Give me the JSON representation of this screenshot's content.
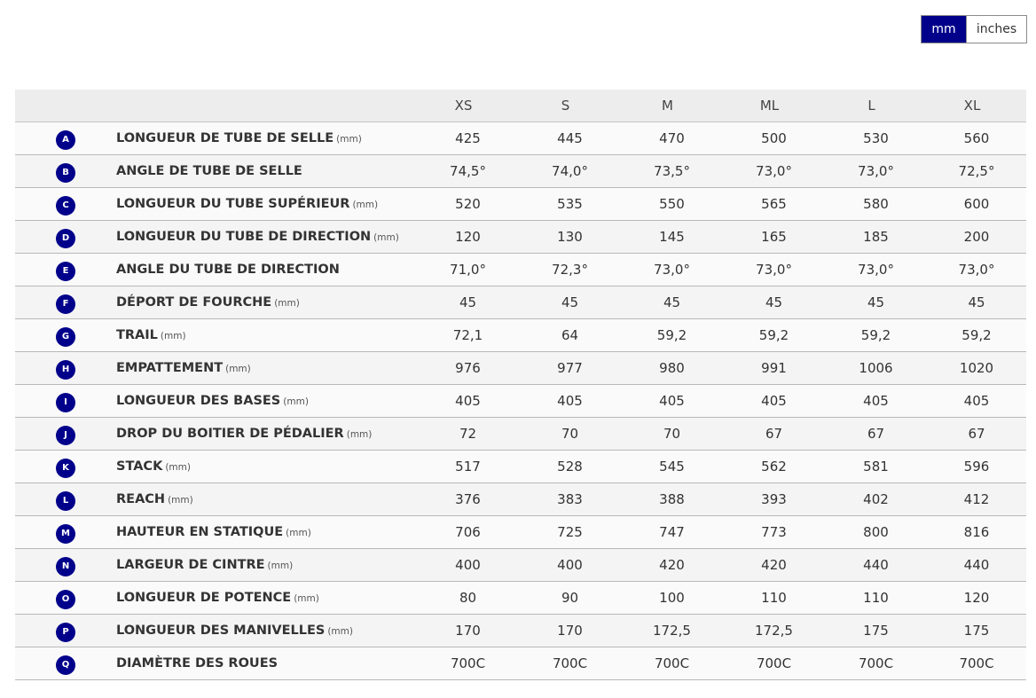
{
  "unit_toggle": {
    "options": [
      "mm",
      "inches"
    ],
    "selected": "mm"
  },
  "colors": {
    "accent": "#00008b",
    "header_bg": "#ededed",
    "row_odd": "#fafafa",
    "row_even": "#f4f4f4"
  },
  "table": {
    "sizes": [
      "XS",
      "S",
      "M",
      "ML",
      "L",
      "XL"
    ],
    "rows": [
      {
        "letter": "A",
        "label": "LONGUEUR DE TUBE DE SELLE",
        "unit": "(mm)",
        "values": [
          "425",
          "445",
          "470",
          "500",
          "530",
          "560"
        ]
      },
      {
        "letter": "B",
        "label": "ANGLE DE TUBE DE SELLE",
        "unit": "",
        "values": [
          "74,5°",
          "74,0°",
          "73,5°",
          "73,0°",
          "73,0°",
          "72,5°"
        ]
      },
      {
        "letter": "C",
        "label": "LONGUEUR DU TUBE SUPÉRIEUR",
        "unit": "(mm)",
        "values": [
          "520",
          "535",
          "550",
          "565",
          "580",
          "600"
        ]
      },
      {
        "letter": "D",
        "label": "LONGUEUR DU TUBE DE DIRECTION",
        "unit": "(mm)",
        "values": [
          "120",
          "130",
          "145",
          "165",
          "185",
          "200"
        ]
      },
      {
        "letter": "E",
        "label": "ANGLE DU TUBE DE DIRECTION",
        "unit": "",
        "values": [
          "71,0°",
          "72,3°",
          "73,0°",
          "73,0°",
          "73,0°",
          "73,0°"
        ]
      },
      {
        "letter": "F",
        "label": "DÉPORT DE FOURCHE",
        "unit": "(mm)",
        "values": [
          "45",
          "45",
          "45",
          "45",
          "45",
          "45"
        ]
      },
      {
        "letter": "G",
        "label": "TRAIL",
        "unit": "(mm)",
        "values": [
          "72,1",
          "64",
          "59,2",
          "59,2",
          "59,2",
          "59,2"
        ]
      },
      {
        "letter": "H",
        "label": "EMPATTEMENT",
        "unit": "(mm)",
        "values": [
          "976",
          "977",
          "980",
          "991",
          "1006",
          "1020"
        ]
      },
      {
        "letter": "I",
        "label": "LONGUEUR DES BASES",
        "unit": "(mm)",
        "values": [
          "405",
          "405",
          "405",
          "405",
          "405",
          "405"
        ]
      },
      {
        "letter": "J",
        "label": "DROP DU BOITIER DE PÉDALIER",
        "unit": "(mm)",
        "values": [
          "72",
          "70",
          "70",
          "67",
          "67",
          "67"
        ]
      },
      {
        "letter": "K",
        "label": "STACK",
        "unit": "(mm)",
        "values": [
          "517",
          "528",
          "545",
          "562",
          "581",
          "596"
        ]
      },
      {
        "letter": "L",
        "label": "REACH",
        "unit": "(mm)",
        "values": [
          "376",
          "383",
          "388",
          "393",
          "402",
          "412"
        ]
      },
      {
        "letter": "M",
        "label": "HAUTEUR EN STATIQUE",
        "unit": "(mm)",
        "values": [
          "706",
          "725",
          "747",
          "773",
          "800",
          "816"
        ]
      },
      {
        "letter": "N",
        "label": "LARGEUR DE CINTRE",
        "unit": "(mm)",
        "values": [
          "400",
          "400",
          "420",
          "420",
          "440",
          "440"
        ]
      },
      {
        "letter": "O",
        "label": "LONGUEUR DE POTENCE",
        "unit": "(mm)",
        "values": [
          "80",
          "90",
          "100",
          "110",
          "110",
          "120"
        ]
      },
      {
        "letter": "P",
        "label": "LONGUEUR DES MANIVELLES",
        "unit": "(mm)",
        "values": [
          "170",
          "170",
          "172,5",
          "172,5",
          "175",
          "175"
        ]
      },
      {
        "letter": "Q",
        "label": "DIAMÈTRE DES ROUES",
        "unit": "",
        "values": [
          "700C",
          "700C",
          "700C",
          "700C",
          "700C",
          "700C"
        ]
      }
    ]
  }
}
